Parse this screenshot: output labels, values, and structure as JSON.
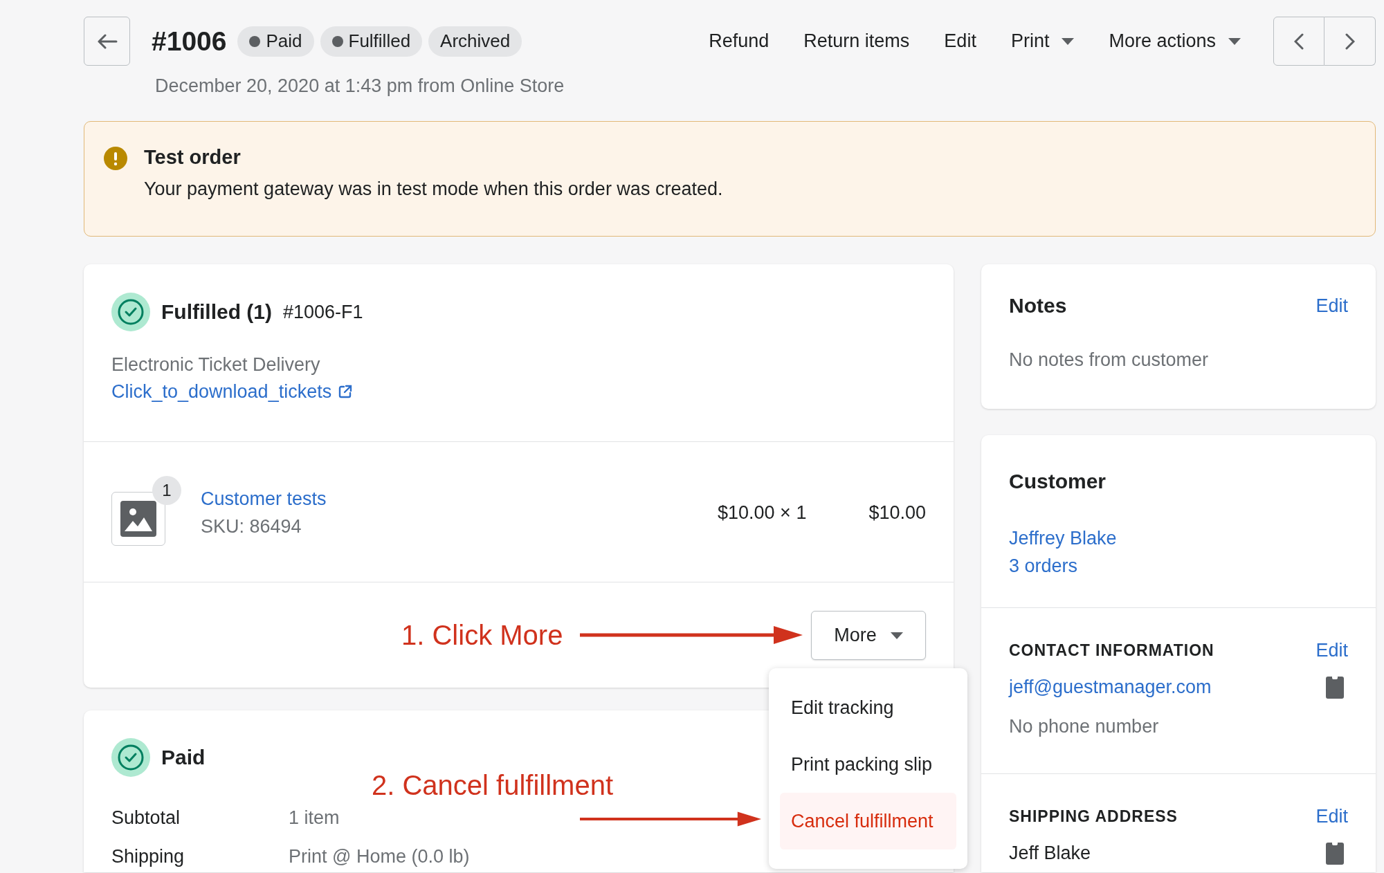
{
  "header": {
    "order_number": "#1006",
    "badges": [
      {
        "label": "Paid",
        "dot": true
      },
      {
        "label": "Fulfilled",
        "dot": true
      },
      {
        "label": "Archived",
        "dot": false
      }
    ],
    "subtitle": "December 20, 2020 at 1:43 pm from Online Store",
    "actions": [
      {
        "label": "Refund",
        "dropdown": false
      },
      {
        "label": "Return items",
        "dropdown": false
      },
      {
        "label": "Edit",
        "dropdown": false
      },
      {
        "label": "Print",
        "dropdown": true
      },
      {
        "label": "More actions",
        "dropdown": true
      }
    ]
  },
  "banner": {
    "title": "Test order",
    "message": "Your payment gateway was in test mode when this order was created."
  },
  "fulfillment": {
    "title": "Fulfilled (1)",
    "id": "#1006-F1",
    "delivery_method": "Electronic Ticket Delivery",
    "link": "Click_to_download_tickets",
    "item": {
      "quantity": "1",
      "name": "Customer tests",
      "sku": "SKU: 86494",
      "unit_price": "$10.00 × 1",
      "total": "$10.00"
    },
    "more_button": "More",
    "menu": [
      {
        "label": "Edit tracking",
        "selected": false
      },
      {
        "label": "Print packing slip",
        "selected": false
      },
      {
        "label": "Cancel fulfillment",
        "selected": true
      }
    ]
  },
  "payment": {
    "title": "Paid",
    "rows": [
      {
        "label": "Subtotal",
        "detail": "1 item"
      },
      {
        "label": "Shipping",
        "detail": "Print @ Home (0.0 lb)"
      }
    ]
  },
  "notes": {
    "title": "Notes",
    "edit": "Edit",
    "text": "No notes from customer"
  },
  "customer": {
    "title": "Customer",
    "name": "Jeffrey Blake",
    "orders": "3 orders",
    "sections": [
      {
        "title": "CONTACT INFORMATION",
        "edit": "Edit",
        "lines": [
          {
            "text": "jeff@guestmanager.com",
            "kind": "link",
            "copy": true
          },
          {
            "text": "No phone number",
            "kind": "muted",
            "copy": false
          }
        ]
      },
      {
        "title": "SHIPPING ADDRESS",
        "edit": "Edit",
        "lines": [
          {
            "text": "Jeff Blake",
            "kind": "plain",
            "copy": true
          }
        ]
      }
    ]
  },
  "annotations": [
    {
      "text": "1. Click More"
    },
    {
      "text": "2. Cancel fulfillment"
    }
  ]
}
